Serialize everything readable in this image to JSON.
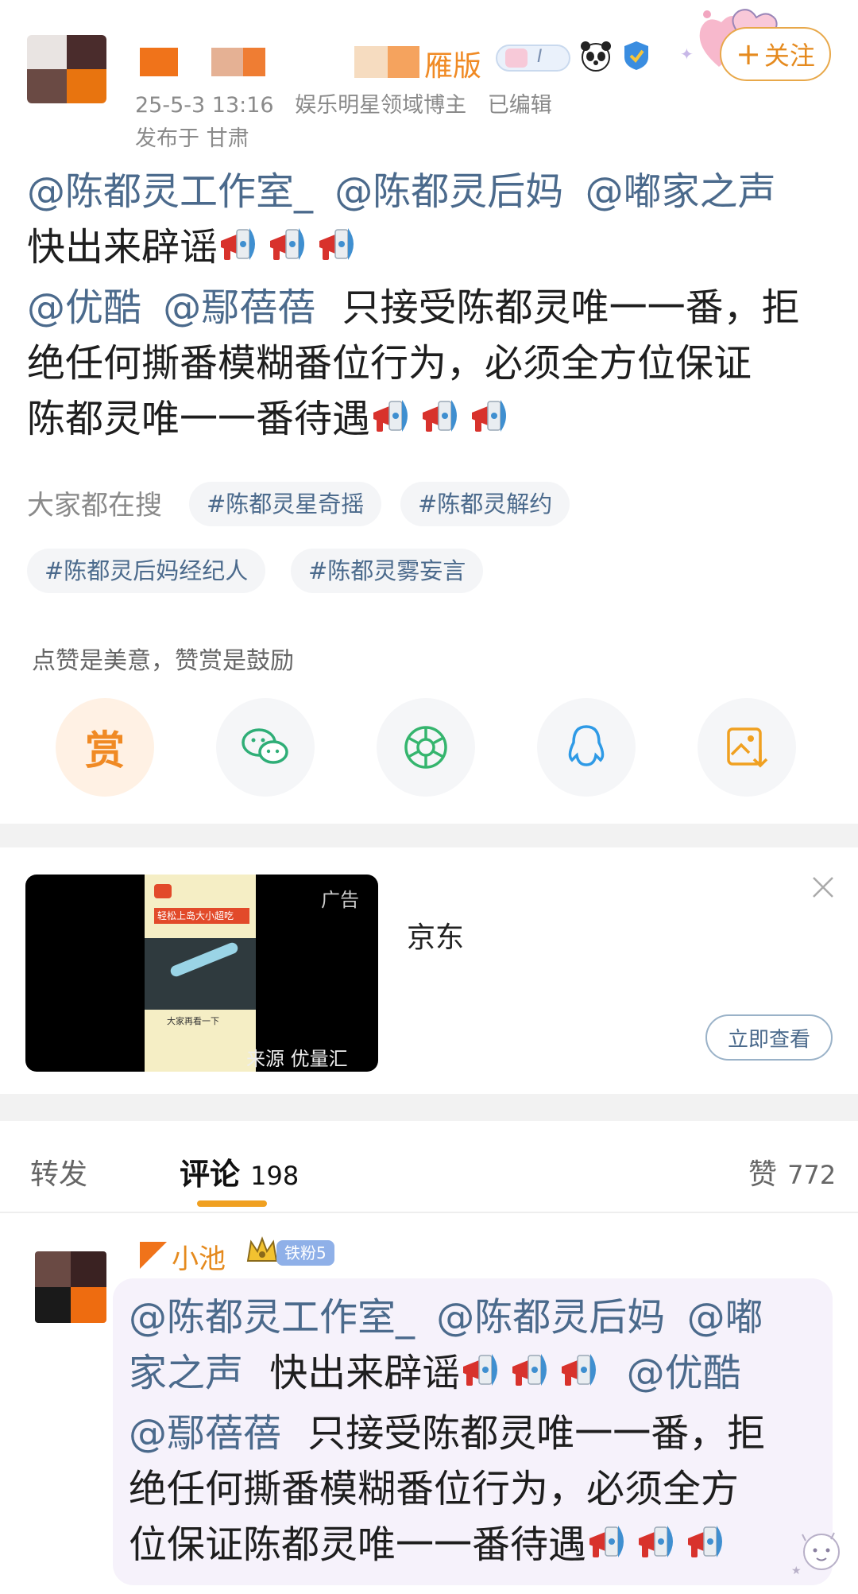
{
  "post": {
    "meta_date": "25-5-3 13:16",
    "meta_role": "娱乐明星领域博主",
    "meta_edited": "已编辑",
    "publish_location": "发布于 甘肃",
    "name_suffix": "雁版",
    "follow_label": "关注",
    "mention_studio": "@陈都灵工作室_",
    "mention_stepmom": "@陈都灵后妈",
    "mention_voice": "@嘟家之声",
    "text_line2": "快出来辟谣",
    "mention_youku": "@优酷",
    "mention_zheng": "@鄢蓓蓓",
    "text_line3": "只接受陈都灵唯一一番，拒",
    "text_line4": "绝任何撕番模糊番位行为，必须全方位保证",
    "text_line5": "陈都灵唯一一番待遇"
  },
  "search": {
    "label": "大家都在搜",
    "topics": [
      "#陈都灵星奇摇",
      "#陈都灵解约",
      "#陈都灵后妈经纪人",
      "#陈都灵雾妄言"
    ]
  },
  "reward": {
    "caption": "点赞是美意，赞赏是鼓励",
    "reward_glyph": "赏"
  },
  "share_icons": [
    "reward-icon",
    "wechat-icon",
    "moments-icon",
    "qq-icon",
    "save-image-icon"
  ],
  "ad": {
    "badge": "广告",
    "advertiser": "京东",
    "source": "来源 优量汇",
    "cta": "立即查看",
    "video_caption": "轻松上岛大小超吃",
    "video_subtitle": "大家再看一下"
  },
  "tabs": {
    "repost": "转发",
    "comment": "评论",
    "comment_count": "198",
    "like": "赞",
    "like_count": "772"
  },
  "comment": {
    "username": "小池",
    "fan_badge": "铁粉5",
    "line1_a": "@陈都灵工作室_",
    "line1_b": "@陈都灵后妈",
    "line1_c": "@嘟",
    "line2_a": "家之声",
    "line2_b": "快出来辟谣",
    "line2_c": "@优酷",
    "line3_a": "@鄢蓓蓓",
    "line3_b": "只接受陈都灵唯一一番，拒",
    "line4": "绝任何撕番模糊番位行为，必须全方",
    "line5": "位保证陈都灵唯一一番待遇"
  },
  "colors": {
    "link": "#4b6a8c",
    "accent_orange": "#f08a24",
    "tab_indicator": "#f0a020",
    "follow_border": "#e8a84a",
    "megaphone_red": "#d8322c",
    "megaphone_blue": "#3f8fd0"
  }
}
